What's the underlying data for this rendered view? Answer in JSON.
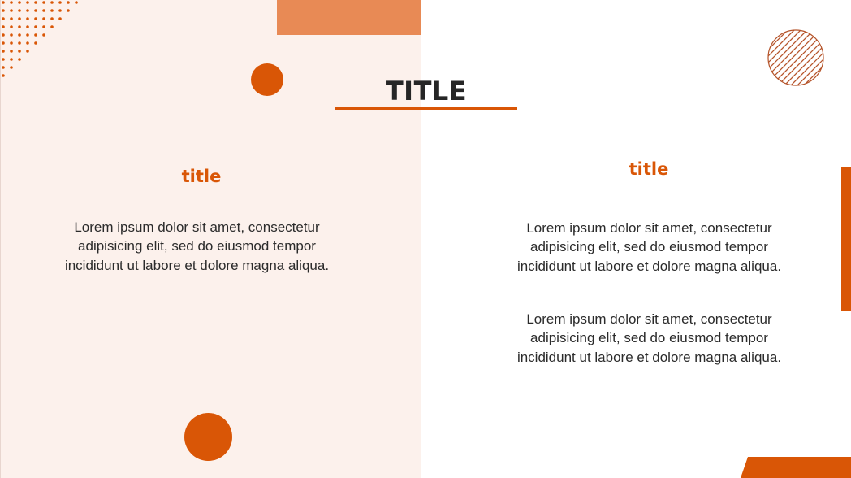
{
  "slide": {
    "title": "TITLE",
    "left": {
      "title": "title",
      "paragraph": "Lorem ipsum dolor sit amet, consectetur adipisicing elit, sed do eiusmod tempor incididunt ut labore et dolore magna aliqua."
    },
    "right": {
      "title": "title",
      "paragraphs": [
        "Lorem ipsum dolor sit amet, consectetur adipisicing elit, sed do eiusmod tempor incididunt ut labore et dolore magna aliqua.",
        "Lorem ipsum dolor sit amet, consectetur adipisicing elit, sed do eiusmod tempor incididunt ut labore et dolore magna aliqua."
      ]
    }
  },
  "colors": {
    "accent": "#d95606",
    "accent_light": "#e88a55",
    "panel_background": "#fcf1ec",
    "title_text": "#262626",
    "body_text": "#2b2b2b"
  }
}
